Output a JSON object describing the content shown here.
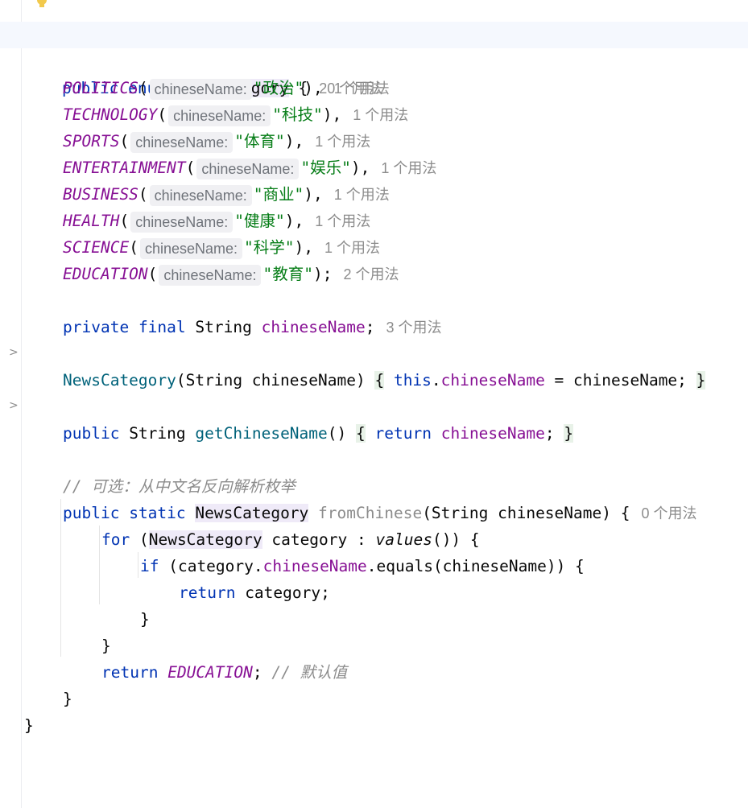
{
  "editor": {
    "header": {
      "kw_public": "public",
      "kw_enum": "enum",
      "class_name": "NewsCategory",
      "brace": "{",
      "usages": "20 个用法"
    },
    "param_hint": "chineseName:",
    "constants": [
      {
        "name": "POLITICS",
        "value": "\"政治\"",
        "end": "),",
        "usages": "1 个用法"
      },
      {
        "name": "TECHNOLOGY",
        "value": "\"科技\"",
        "end": "),",
        "usages": "1 个用法"
      },
      {
        "name": "SPORTS",
        "value": "\"体育\"",
        "end": "),",
        "usages": "1 个用法"
      },
      {
        "name": "ENTERTAINMENT",
        "value": "\"娱乐\"",
        "end": "),",
        "usages": "1 个用法"
      },
      {
        "name": "BUSINESS",
        "value": "\"商业\"",
        "end": "),",
        "usages": "1 个用法"
      },
      {
        "name": "HEALTH",
        "value": "\"健康\"",
        "end": "),",
        "usages": "1 个用法"
      },
      {
        "name": "SCIENCE",
        "value": "\"科学\"",
        "end": "),",
        "usages": "1 个用法"
      },
      {
        "name": "EDUCATION",
        "value": "\"教育\"",
        "end": ");",
        "usages": "2 个用法"
      }
    ],
    "field": {
      "kw_private": "private",
      "kw_final": "final",
      "type": "String",
      "name": "chineseName",
      "semi": ";",
      "usages": "3 个用法"
    },
    "ctor": {
      "name": "NewsCategory",
      "params": "(String chineseName)",
      "open": "{",
      "kw_this": "this",
      "dot": ".",
      "field": "chineseName",
      "rest": " = chineseName;",
      "close": "}"
    },
    "getter": {
      "kw_public": "public",
      "type": "String",
      "name": "getChineseName",
      "parens": "()",
      "open": "{",
      "kw_return": "return",
      "field": "chineseName",
      "semi": ";",
      "close": "}"
    },
    "comment": "// 可选：从中文名反向解析枚举",
    "from_chinese": {
      "kw_public": "public",
      "kw_static": "static",
      "type": "NewsCategory",
      "name": "fromChinese",
      "params": "(String chineseName) {",
      "usages": "0 个用法"
    },
    "for_line": {
      "kw_for": "for",
      "open": " (",
      "type": "NewsCategory",
      "mid": " category : ",
      "call": "values",
      "end": "()) {"
    },
    "if_line": {
      "kw_if": "if",
      "pre": " (category.",
      "field": "chineseName",
      "end": ".equals(chineseName)) {"
    },
    "return_cat": {
      "kw_return": "return",
      "rest": " category;"
    },
    "close_brace": "}",
    "return_default": {
      "kw_return": "return",
      "constant": "EDUCATION",
      "semi": ";",
      "comment": "// 默认值"
    },
    "fold_marker": ">"
  }
}
